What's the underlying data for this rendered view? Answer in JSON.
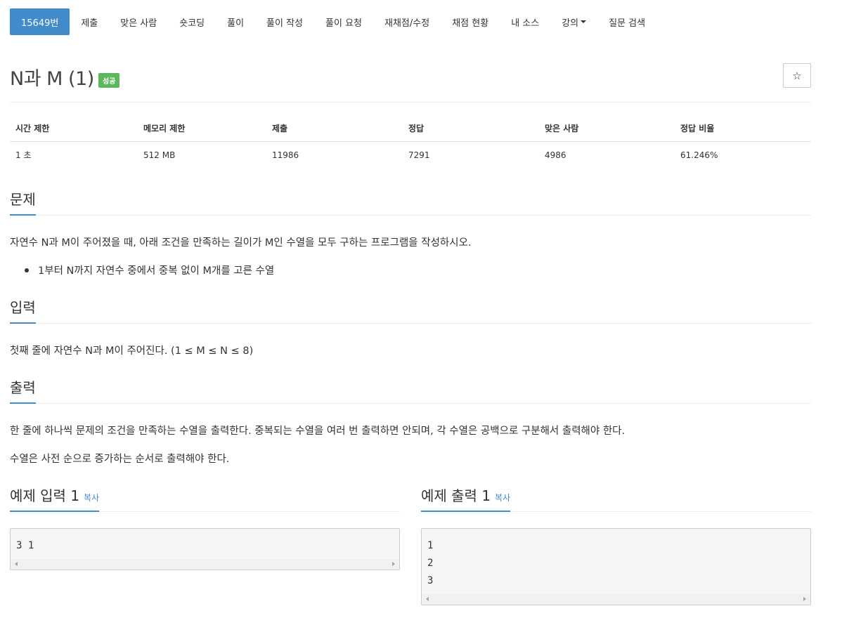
{
  "nav": {
    "tabs": [
      {
        "label": "15649번",
        "active": true
      },
      {
        "label": "제출"
      },
      {
        "label": "맞은 사람"
      },
      {
        "label": "숏코딩"
      },
      {
        "label": "풀이"
      },
      {
        "label": "풀이 작성"
      },
      {
        "label": "풀이 요청"
      },
      {
        "label": "재채점/수정"
      },
      {
        "label": "채점 현황"
      },
      {
        "label": "내 소스"
      },
      {
        "label": "강의",
        "dropdown": true
      },
      {
        "label": "질문 검색"
      }
    ]
  },
  "problem": {
    "title": "N과 M (1)",
    "status_badge": "성공",
    "star_icon": "☆"
  },
  "stats": {
    "headers": [
      "시간 제한",
      "메모리 제한",
      "제출",
      "정답",
      "맞은 사람",
      "정답 비율"
    ],
    "values": [
      "1 초",
      "512 MB",
      "11986",
      "7291",
      "4986",
      "61.246%"
    ]
  },
  "sections": {
    "description": {
      "heading": "문제",
      "text": "자연수 N과 M이 주어졌을 때, 아래 조건을 만족하는 길이가 M인 수열을 모두 구하는 프로그램을 작성하시오.",
      "bullets": [
        "1부터 N까지 자연수 중에서 중복 없이 M개를 고른 수열"
      ]
    },
    "input": {
      "heading": "입력",
      "text": "첫째 줄에 자연수 N과 M이 주어진다. (1 ≤ M ≤ N ≤ 8)"
    },
    "output": {
      "heading": "출력",
      "text1": "한 줄에 하나씩 문제의 조건을 만족하는 수열을 출력한다. 중복되는 수열을 여러 번 출력하면 안되며, 각 수열은 공백으로 구분해서 출력해야 한다.",
      "text2": "수열은 사전 순으로 증가하는 순서로 출력해야 한다."
    },
    "sample_input": {
      "heading": "예제 입력 1",
      "copy_label": "복사",
      "lines": [
        "3 1"
      ]
    },
    "sample_output": {
      "heading": "예제 출력 1",
      "copy_label": "복사",
      "lines": [
        "1",
        "2",
        "3"
      ]
    }
  },
  "colors": {
    "accent": "#428bca",
    "success": "#5cb85c"
  }
}
